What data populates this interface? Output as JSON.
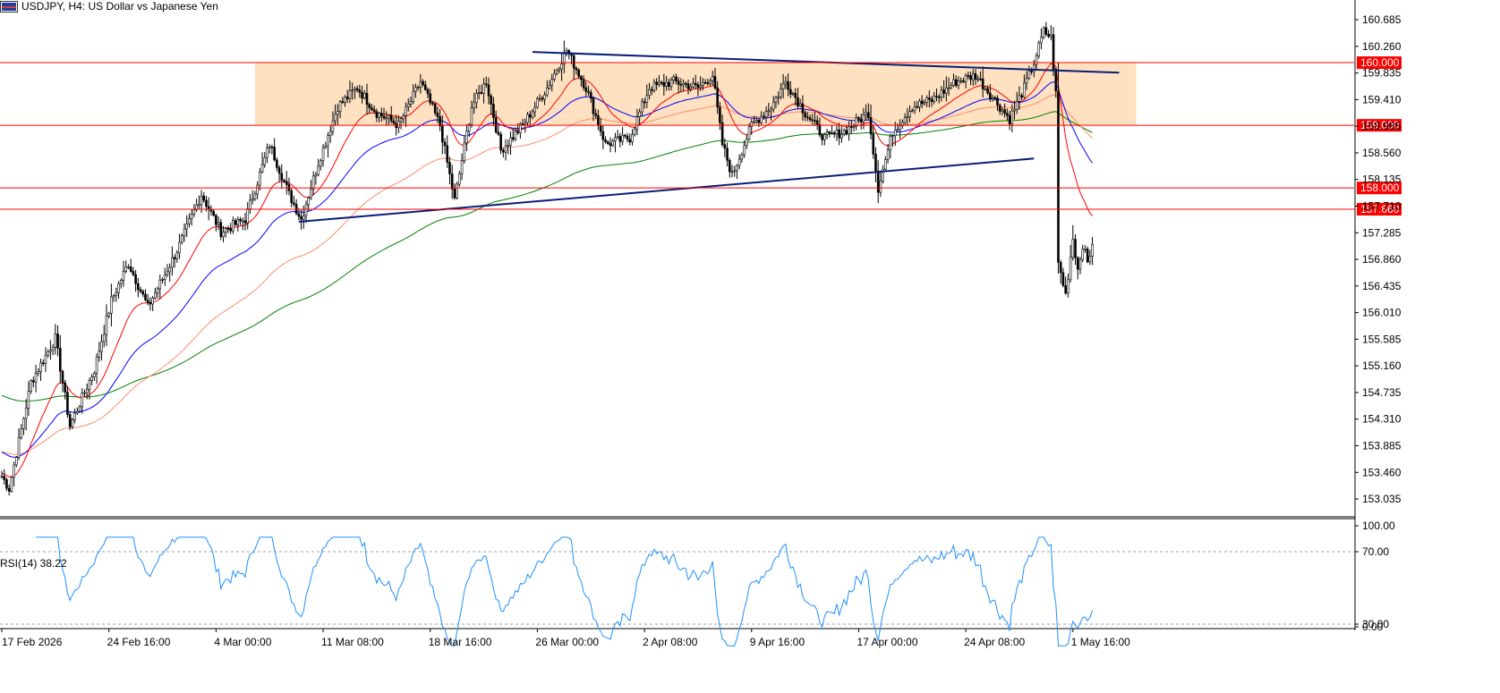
{
  "header": {
    "title": "USDJPY, H4:  US Dollar vs Japanese Yen"
  },
  "rsi_panel": {
    "label": "RSI(14) 38.22"
  },
  "colors": {
    "background": "#ffffff",
    "bull_body": "#ffffff",
    "bear_body": "#000000",
    "candle_outline": "#000000",
    "ema_fast": "#ff0000",
    "ema_mid": "#0000ff",
    "ema_slow": "#ff8c69",
    "ema_long": "#008000",
    "trendline": "#0a1e78",
    "horizontal_level": "#ff0000",
    "level_label_bg": "#ff0000",
    "range_zone": "#fde1c0",
    "rsi_line": "#1e90ff",
    "rsi_level": "#a0a0a0"
  },
  "chart_data": {
    "type": "candlestick",
    "symbol": "USDJPY",
    "timeframe": "H4",
    "price_axis": {
      "ticks": [
        "160.685",
        "160.260",
        "159.835",
        "159.410",
        "158.985",
        "158.560",
        "158.135",
        "157.710",
        "157.285",
        "156.860",
        "156.435",
        "156.010",
        "155.585",
        "155.160",
        "154.735",
        "154.310",
        "153.885",
        "153.460",
        "153.035"
      ],
      "range": [
        152.75,
        161.0
      ]
    },
    "time_axis": {
      "labels": [
        "17 Feb 2026",
        "24 Feb 16:00",
        "4 Mar 00:00",
        "11 Mar 08:00",
        "18 Mar 16:00",
        "26 Mar 00:00",
        "2 Apr 08:00",
        "9 Apr 16:00",
        "17 Apr 00:00",
        "24 Apr 08:00",
        "1 May 16:00"
      ],
      "label_bars": [
        0,
        44,
        88,
        132,
        176,
        220,
        264,
        308,
        352,
        396,
        440
      ]
    },
    "levels": [
      {
        "price": 160.0,
        "label": "160.000"
      },
      {
        "price": 159.0,
        "label": "159.000"
      },
      {
        "price": 158.0,
        "label": "158.000"
      },
      {
        "price": 157.66,
        "label": "157.660"
      }
    ],
    "range_zone": {
      "from_bar": 104,
      "to_bar": 466,
      "high": 160.0,
      "low": 159.0
    },
    "trendlines": [
      {
        "from": {
          "bar": 218,
          "price": 160.17
        },
        "to": {
          "bar": 459,
          "price": 159.84
        }
      },
      {
        "from": {
          "bar": 122,
          "price": 157.46
        },
        "to": {
          "bar": 424,
          "price": 158.47
        }
      }
    ],
    "key_prices": [
      {
        "bar": 0,
        "price": 153.4
      },
      {
        "bar": 3,
        "price": 153.2
      },
      {
        "bar": 12,
        "price": 154.9
      },
      {
        "bar": 22,
        "price": 155.6
      },
      {
        "bar": 28,
        "price": 154.2
      },
      {
        "bar": 38,
        "price": 155.1
      },
      {
        "bar": 45,
        "price": 156.2
      },
      {
        "bar": 52,
        "price": 156.8
      },
      {
        "bar": 60,
        "price": 156.1
      },
      {
        "bar": 72,
        "price": 157.0
      },
      {
        "bar": 82,
        "price": 157.9
      },
      {
        "bar": 90,
        "price": 157.3
      },
      {
        "bar": 100,
        "price": 157.5
      },
      {
        "bar": 110,
        "price": 158.7
      },
      {
        "bar": 118,
        "price": 157.9
      },
      {
        "bar": 123,
        "price": 157.5
      },
      {
        "bar": 130,
        "price": 158.4
      },
      {
        "bar": 138,
        "price": 159.3
      },
      {
        "bar": 146,
        "price": 159.6
      },
      {
        "bar": 154,
        "price": 159.2
      },
      {
        "bar": 163,
        "price": 159.0
      },
      {
        "bar": 172,
        "price": 159.7
      },
      {
        "bar": 180,
        "price": 159.0
      },
      {
        "bar": 186,
        "price": 157.8
      },
      {
        "bar": 193,
        "price": 159.3
      },
      {
        "bar": 199,
        "price": 159.7
      },
      {
        "bar": 205,
        "price": 158.6
      },
      {
        "bar": 214,
        "price": 159.0
      },
      {
        "bar": 224,
        "price": 159.6
      },
      {
        "bar": 232,
        "price": 160.2
      },
      {
        "bar": 240,
        "price": 159.6
      },
      {
        "bar": 248,
        "price": 158.7
      },
      {
        "bar": 258,
        "price": 158.8
      },
      {
        "bar": 266,
        "price": 159.6
      },
      {
        "bar": 276,
        "price": 159.7
      },
      {
        "bar": 286,
        "price": 159.6
      },
      {
        "bar": 292,
        "price": 159.8
      },
      {
        "bar": 296,
        "price": 158.7
      },
      {
        "bar": 300,
        "price": 158.2
      },
      {
        "bar": 308,
        "price": 159.0
      },
      {
        "bar": 316,
        "price": 159.3
      },
      {
        "bar": 322,
        "price": 159.7
      },
      {
        "bar": 330,
        "price": 159.2
      },
      {
        "bar": 338,
        "price": 158.8
      },
      {
        "bar": 346,
        "price": 158.9
      },
      {
        "bar": 356,
        "price": 159.2
      },
      {
        "bar": 360,
        "price": 158.0
      },
      {
        "bar": 366,
        "price": 158.9
      },
      {
        "bar": 374,
        "price": 159.3
      },
      {
        "bar": 382,
        "price": 159.4
      },
      {
        "bar": 392,
        "price": 159.7
      },
      {
        "bar": 400,
        "price": 159.8
      },
      {
        "bar": 408,
        "price": 159.4
      },
      {
        "bar": 414,
        "price": 159.1
      },
      {
        "bar": 420,
        "price": 159.6
      },
      {
        "bar": 424,
        "price": 160.0
      },
      {
        "bar": 428,
        "price": 160.5
      },
      {
        "bar": 431,
        "price": 160.4
      },
      {
        "bar": 433,
        "price": 159.5
      },
      {
        "bar": 434,
        "price": 156.8
      },
      {
        "bar": 437,
        "price": 156.3
      },
      {
        "bar": 440,
        "price": 157.2
      },
      {
        "bar": 442,
        "price": 156.7
      },
      {
        "bar": 444,
        "price": 157.1
      },
      {
        "bar": 446,
        "price": 156.8
      },
      {
        "bar": 448,
        "price": 157.1
      }
    ],
    "gap_bars": [],
    "rsi": {
      "period": 14,
      "last_value": 38.22,
      "axis_ticks": [
        "100.00",
        "70.00",
        "30.00",
        "0.00"
      ],
      "levels": [
        70,
        30
      ],
      "range": [
        0,
        100
      ]
    }
  }
}
